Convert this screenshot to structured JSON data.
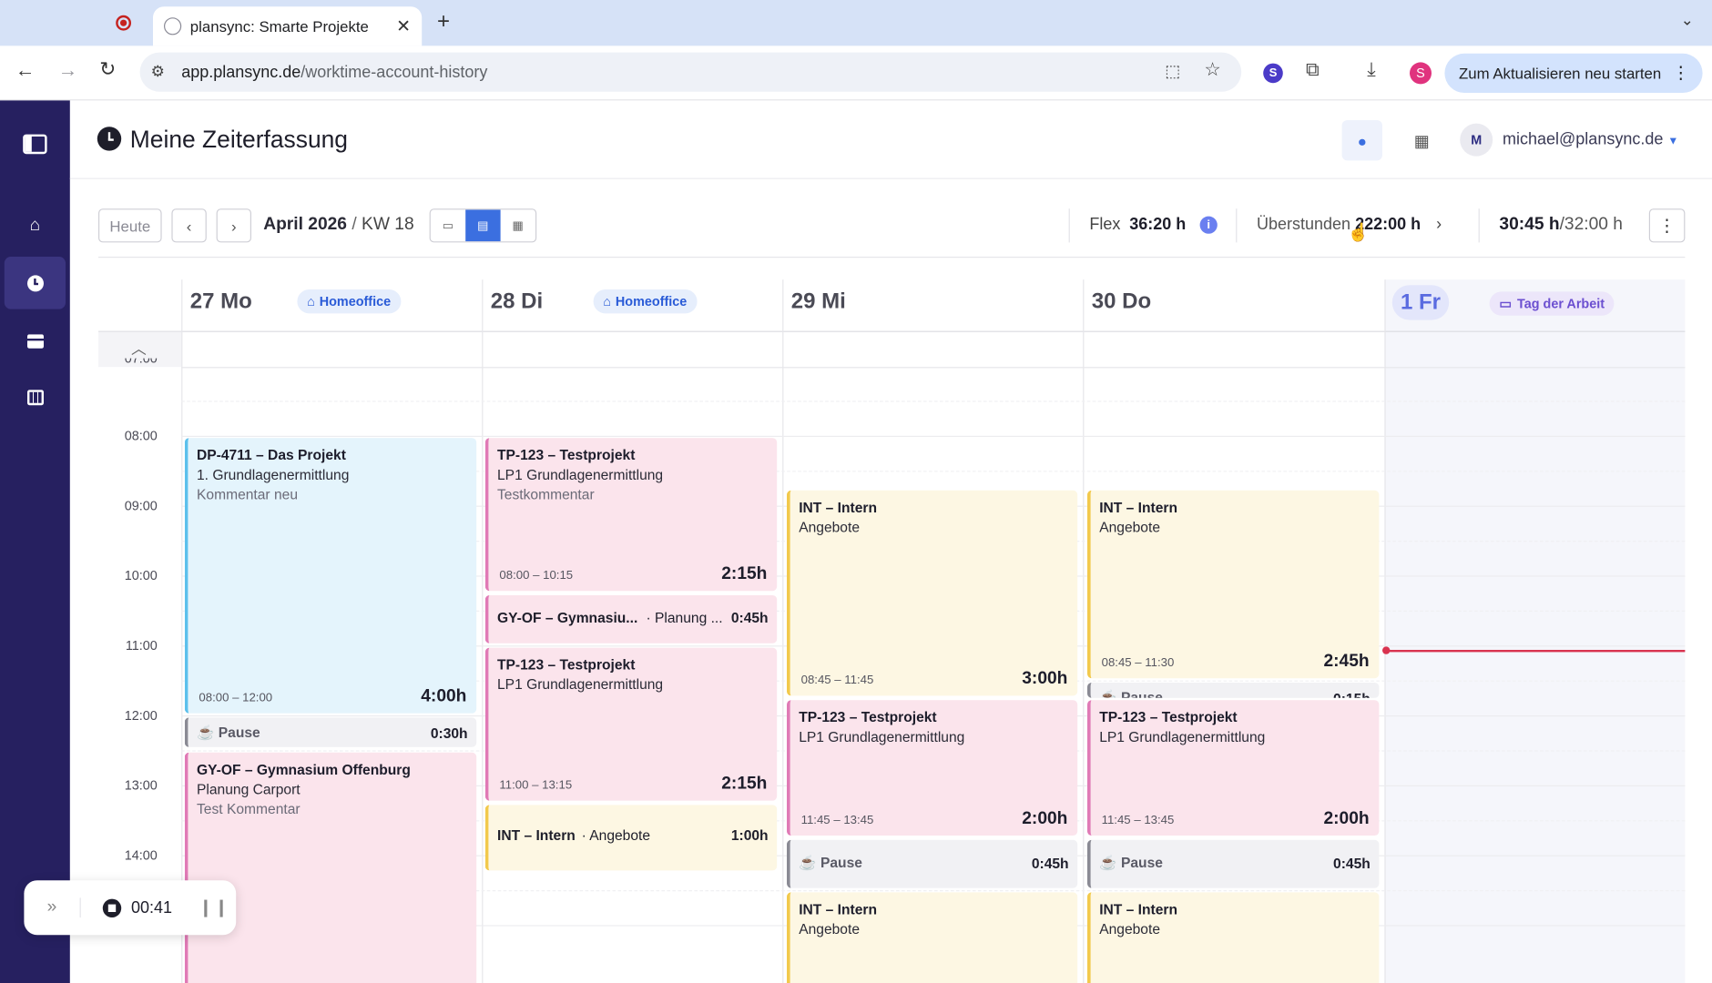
{
  "browser": {
    "tab_title": "plansync: Smarte Projekte",
    "url_host": "app.plansync.de",
    "url_path": "/worktime-account-history",
    "update_button": "Zum Aktualisieren neu starten",
    "profile_initial": "S",
    "ext_initial": "S"
  },
  "header": {
    "title": "Meine Zeiterfassung",
    "user_initial": "M",
    "user_email": "michael@plansync.de"
  },
  "toolbar": {
    "today": "Heute",
    "period_month": "April 2026",
    "period_sep": "/",
    "period_week": "KW 18",
    "flex_label": "Flex",
    "flex_value": "36:20 h",
    "overtime_label": "Überstunden",
    "overtime_value": "222:00 h",
    "hours_done": "30:45 h",
    "hours_target": "/32:00 h"
  },
  "days": [
    {
      "num": "27",
      "name": "Mo",
      "badge": "Homeoffice"
    },
    {
      "num": "28",
      "name": "Di",
      "badge": "Homeoffice"
    },
    {
      "num": "29",
      "name": "Mi",
      "badge": ""
    },
    {
      "num": "30",
      "name": "Do",
      "badge": ""
    },
    {
      "num": "1",
      "name": "Fr",
      "badge": "Tag der Arbeit"
    }
  ],
  "times": [
    "07:00",
    "08:00",
    "09:00",
    "10:00",
    "11:00",
    "12:00",
    "13:00",
    "14:00"
  ],
  "events": {
    "mo1": {
      "title": "DP-4711 – Das Projekt",
      "sub": "1. Grundlagenermittlung",
      "comment": "Kommentar neu",
      "time": "08:00 – 12:00",
      "dur": "4:00h"
    },
    "mo_pause": {
      "title": "Pause",
      "dur": "0:30h"
    },
    "mo2": {
      "title": "GY-OF – Gymnasium Offenburg",
      "sub": "Planung Carport",
      "comment": "Test Kommentar"
    },
    "di1": {
      "title": "TP-123 – Testprojekt",
      "sub": "LP1 Grundlagenermittlung",
      "comment": "Testkommentar",
      "time": "08:00 – 10:15",
      "dur": "2:15h"
    },
    "di2": {
      "title": "GY-OF – Gymnasiu...",
      "sub": "· Planung ...",
      "dur": "0:45h"
    },
    "di3": {
      "title": "TP-123 – Testprojekt",
      "sub": "LP1 Grundlagenermittlung",
      "time": "11:00 – 13:15",
      "dur": "2:15h"
    },
    "di4": {
      "title": "INT – Intern",
      "sub": "· Angebote",
      "dur": "1:00h"
    },
    "mi1": {
      "title": "INT – Intern",
      "sub": "Angebote",
      "time": "08:45 – 11:45",
      "dur": "3:00h"
    },
    "mi2": {
      "title": "TP-123 – Testprojekt",
      "sub": "LP1 Grundlagenermittlung",
      "time": "11:45 – 13:45",
      "dur": "2:00h"
    },
    "mi_pause": {
      "title": "Pause",
      "dur": "0:45h"
    },
    "mi3": {
      "title": "INT – Intern",
      "sub": "Angebote"
    },
    "do1": {
      "title": "INT – Intern",
      "sub": "Angebote",
      "time": "08:45 – 11:30",
      "dur": "2:45h"
    },
    "do_pause1": {
      "title": "Pause",
      "dur": "0:15h"
    },
    "do2": {
      "title": "TP-123 – Testprojekt",
      "sub": "LP1 Grundlagenermittlung",
      "time": "11:45 – 13:45",
      "dur": "2:00h"
    },
    "do_pause2": {
      "title": "Pause",
      "dur": "0:45h"
    },
    "do3": {
      "title": "INT – Intern",
      "sub": "Angebote"
    }
  },
  "timer": {
    "value": "00:41"
  },
  "colors": {
    "sidebar": "#262060",
    "accent": "#3b6fe0",
    "now_line": "#d9334f"
  }
}
